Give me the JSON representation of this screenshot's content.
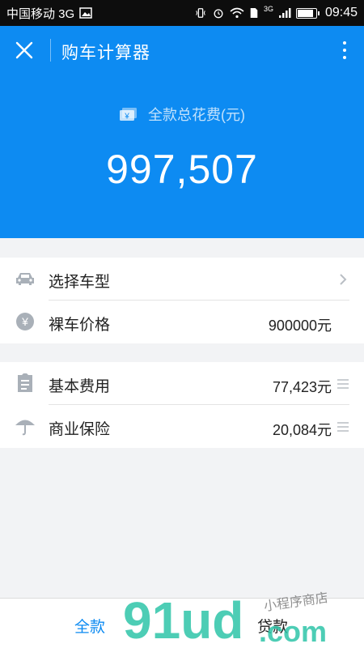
{
  "status_bar": {
    "carrier": "中国移动 3G",
    "network": "3G",
    "time": "09:45",
    "battery_level": 0.8
  },
  "header": {
    "title": "购车计算器",
    "total_label": "全款总花费(元)",
    "total_value": "997,507",
    "currency_icon_glyph": "¥",
    "bg_color": "#0d8bf2"
  },
  "car_section": [
    {
      "icon": "car-icon",
      "label": "选择车型",
      "value": "",
      "trail": "chevron-right-icon"
    },
    {
      "icon": "yen-coin-icon",
      "label": "裸车价格",
      "value": "900000元",
      "trail": ""
    }
  ],
  "fee_section": [
    {
      "icon": "document-icon",
      "label": "基本费用",
      "value": "77,423元",
      "trail": "menu-icon"
    },
    {
      "icon": "umbrella-icon",
      "label": "商业保险",
      "value": "20,084元",
      "trail": "menu-icon"
    }
  ],
  "tabs": {
    "full": "全款",
    "loan": "贷款",
    "active": "full"
  },
  "watermark": {
    "logo": "91ud",
    "domain": ".com",
    "tagline": "小程序商店"
  }
}
